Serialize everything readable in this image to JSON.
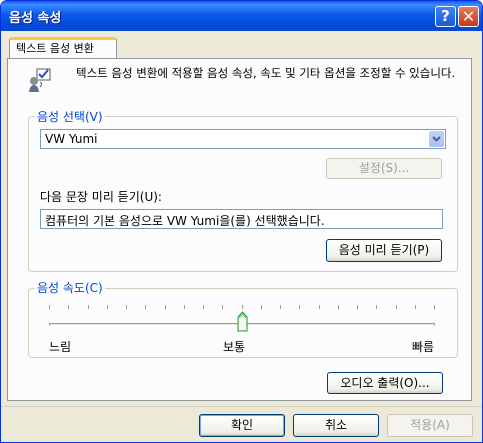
{
  "window": {
    "title": "음성 속성",
    "help_symbol": "?",
    "close_symbol": "✕"
  },
  "tab": {
    "label": "텍스트 음성 변환"
  },
  "description": "텍스트 음성 변환에 적용할 음성 속성, 속도 및 기타 옵션을 조정할 수 있습니다.",
  "voice_selection": {
    "legend": "음성 선택(V)",
    "selected_voice": "VW Yumi",
    "settings_button": "설정(S)...",
    "preview_label": "다음 문장 미리 듣기(U):",
    "preview_text": "컴퓨터의 기본 음성으로 VW Yumi을(를) 선택했습니다.",
    "preview_button": "음성 미리 듣기(P)"
  },
  "voice_speed": {
    "legend": "음성 속도(C)",
    "slow": "느림",
    "normal": "보통",
    "fast": "빠름",
    "level": 0.5
  },
  "audio_output_button": "오디오 출력(O)...",
  "footer": {
    "ok": "확인",
    "cancel": "취소",
    "apply": "적용(A)"
  }
}
